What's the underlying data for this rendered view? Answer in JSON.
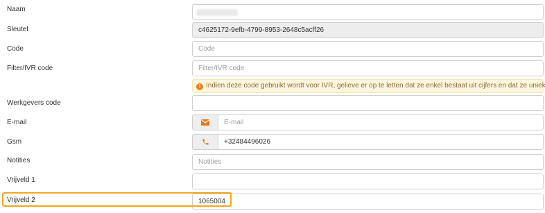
{
  "fields": {
    "naam": {
      "label": "Naam",
      "value": ""
    },
    "sleutel": {
      "label": "Sleutel",
      "value": "c4625172-9efb-4799-8953-2648c5acff26"
    },
    "code": {
      "label": "Code",
      "placeholder": "Code"
    },
    "filter_ivr": {
      "label": "Filter/IVR code",
      "placeholder": "Filter/IVR code",
      "warning": "Indien deze code gebruikt wordt voor IVR, gelieve er op te letten dat ze enkel bestaat uit cijfers en dat ze uniek is"
    },
    "werkgevers": {
      "label": "Werkgevers code",
      "value": ""
    },
    "email": {
      "label": "E-mail",
      "placeholder": "E-mail",
      "icon": "envelope-icon"
    },
    "gsm": {
      "label": "Gsm",
      "value": "+32484496026",
      "icon": "phone-icon"
    },
    "notities": {
      "label": "Notities",
      "placeholder": "Notities"
    },
    "vrijveld1": {
      "label": "Vrijveld 1",
      "value": ""
    },
    "vrijveld2": {
      "label": "Vrijveld 2",
      "value": "1065004"
    }
  },
  "colors": {
    "icon_accent": "#e07b1e",
    "highlight": "#f0a81e",
    "warning_bg": "#fdf6dd",
    "readonly_bg": "#ededed"
  }
}
